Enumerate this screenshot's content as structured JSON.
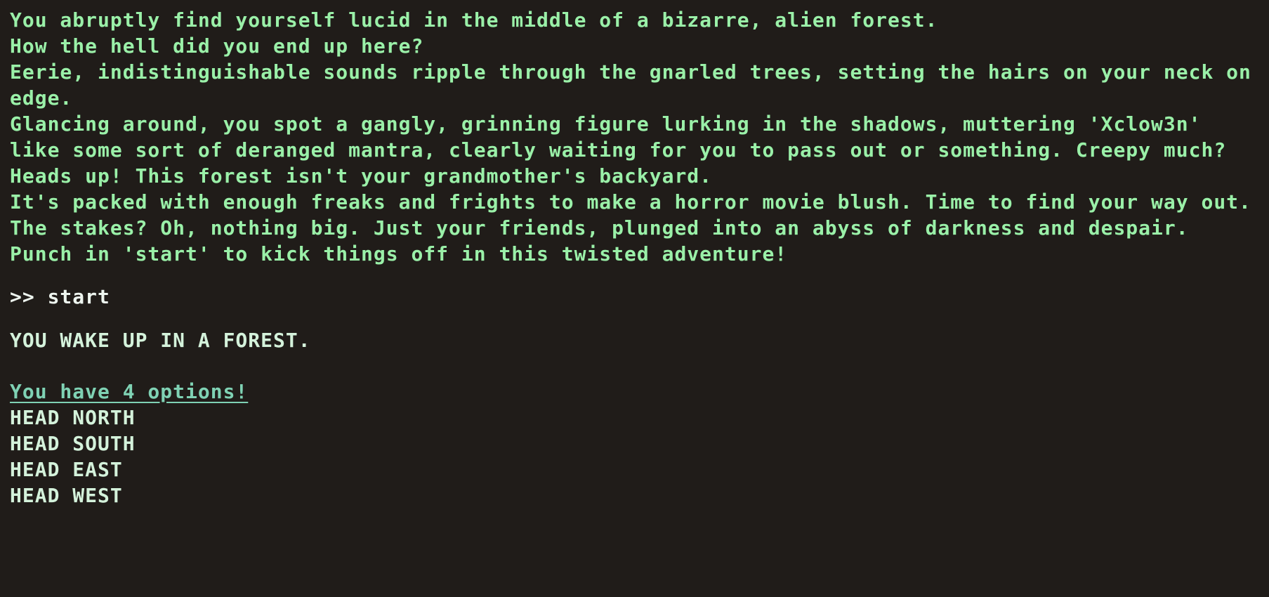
{
  "intro": [
    "You abruptly find yourself lucid in the middle of a bizarre, alien forest.",
    "How the hell did you end up here?",
    "Eerie, indistinguishable sounds ripple through the gnarled trees, setting the hairs on your neck on edge.",
    "Glancing around, you spot a gangly, grinning figure lurking in the shadows, muttering 'Xclow3n' like some sort of deranged mantra, clearly waiting for you to pass out or something. Creepy much?",
    "Heads up! This forest isn't your grandmother's backyard.",
    "It's packed with enough freaks and frights to make a horror movie blush. Time to find your way out.",
    "The stakes? Oh, nothing big. Just your friends, plunged into an abyss of darkness and despair.",
    "Punch in 'start' to kick things off in this twisted adventure!"
  ],
  "input": {
    "prompt": ">> ",
    "command": "start"
  },
  "response": "YOU WAKE UP IN A FOREST.",
  "options": {
    "header": "You have 4 options!",
    "items": [
      "HEAD NORTH",
      "HEAD SOUTH",
      "HEAD EAST",
      "HEAD WEST"
    ]
  },
  "colors": {
    "background": "#201c19",
    "narration": "#9af0a8",
    "command": "#eef5ef",
    "response": "#d4f2db",
    "options_header": "#7fd2b4"
  }
}
